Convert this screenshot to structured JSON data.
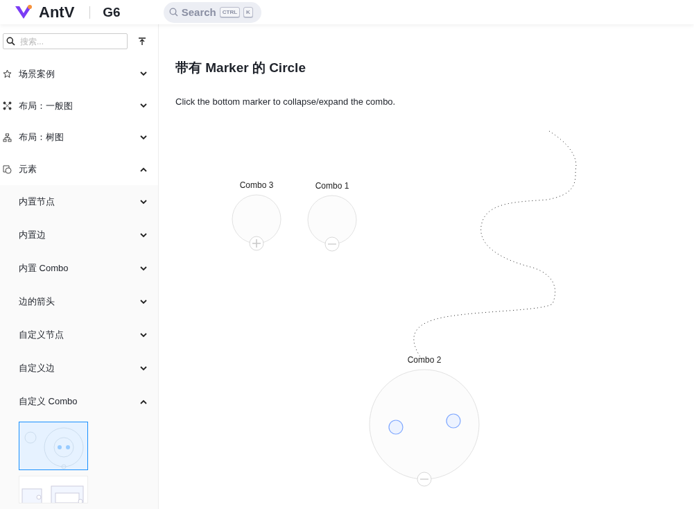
{
  "header": {
    "logo": "AntV",
    "product": "G6",
    "search": {
      "placeholder": "Search",
      "keys": [
        "CTRL",
        "K"
      ]
    }
  },
  "sidebar": {
    "search": {
      "placeholder": "搜索..."
    },
    "items": [
      {
        "label": "场景案例",
        "expanded": false
      },
      {
        "label": "布局：一般图",
        "expanded": false
      },
      {
        "label": "布局：树图",
        "expanded": false
      },
      {
        "label": "元素",
        "expanded": true,
        "children": [
          {
            "label": "内置节点",
            "expanded": false
          },
          {
            "label": "内置边",
            "expanded": false
          },
          {
            "label": "内置 Combo",
            "expanded": false
          },
          {
            "label": "边的箭头",
            "expanded": false
          },
          {
            "label": "自定义节点",
            "expanded": false
          },
          {
            "label": "自定义边",
            "expanded": false
          },
          {
            "label": "自定义 Combo",
            "expanded": true,
            "examples": [
              {
                "kind": "picture",
                "selected": true
              },
              {
                "kind": "picture",
                "selected": false
              }
            ]
          }
        ]
      }
    ]
  },
  "main": {
    "title": "带有 Marker 的 Circle",
    "description": "Click the bottom marker to collapse/expand the combo.",
    "combos": [
      {
        "label": "Combo 3",
        "collapsed": true
      },
      {
        "label": "Combo 1",
        "collapsed": false
      },
      {
        "label": "Combo 2",
        "collapsed": false,
        "nodes": [
          {
            "kind": "circle"
          },
          {
            "kind": "circle"
          }
        ]
      }
    ]
  }
}
